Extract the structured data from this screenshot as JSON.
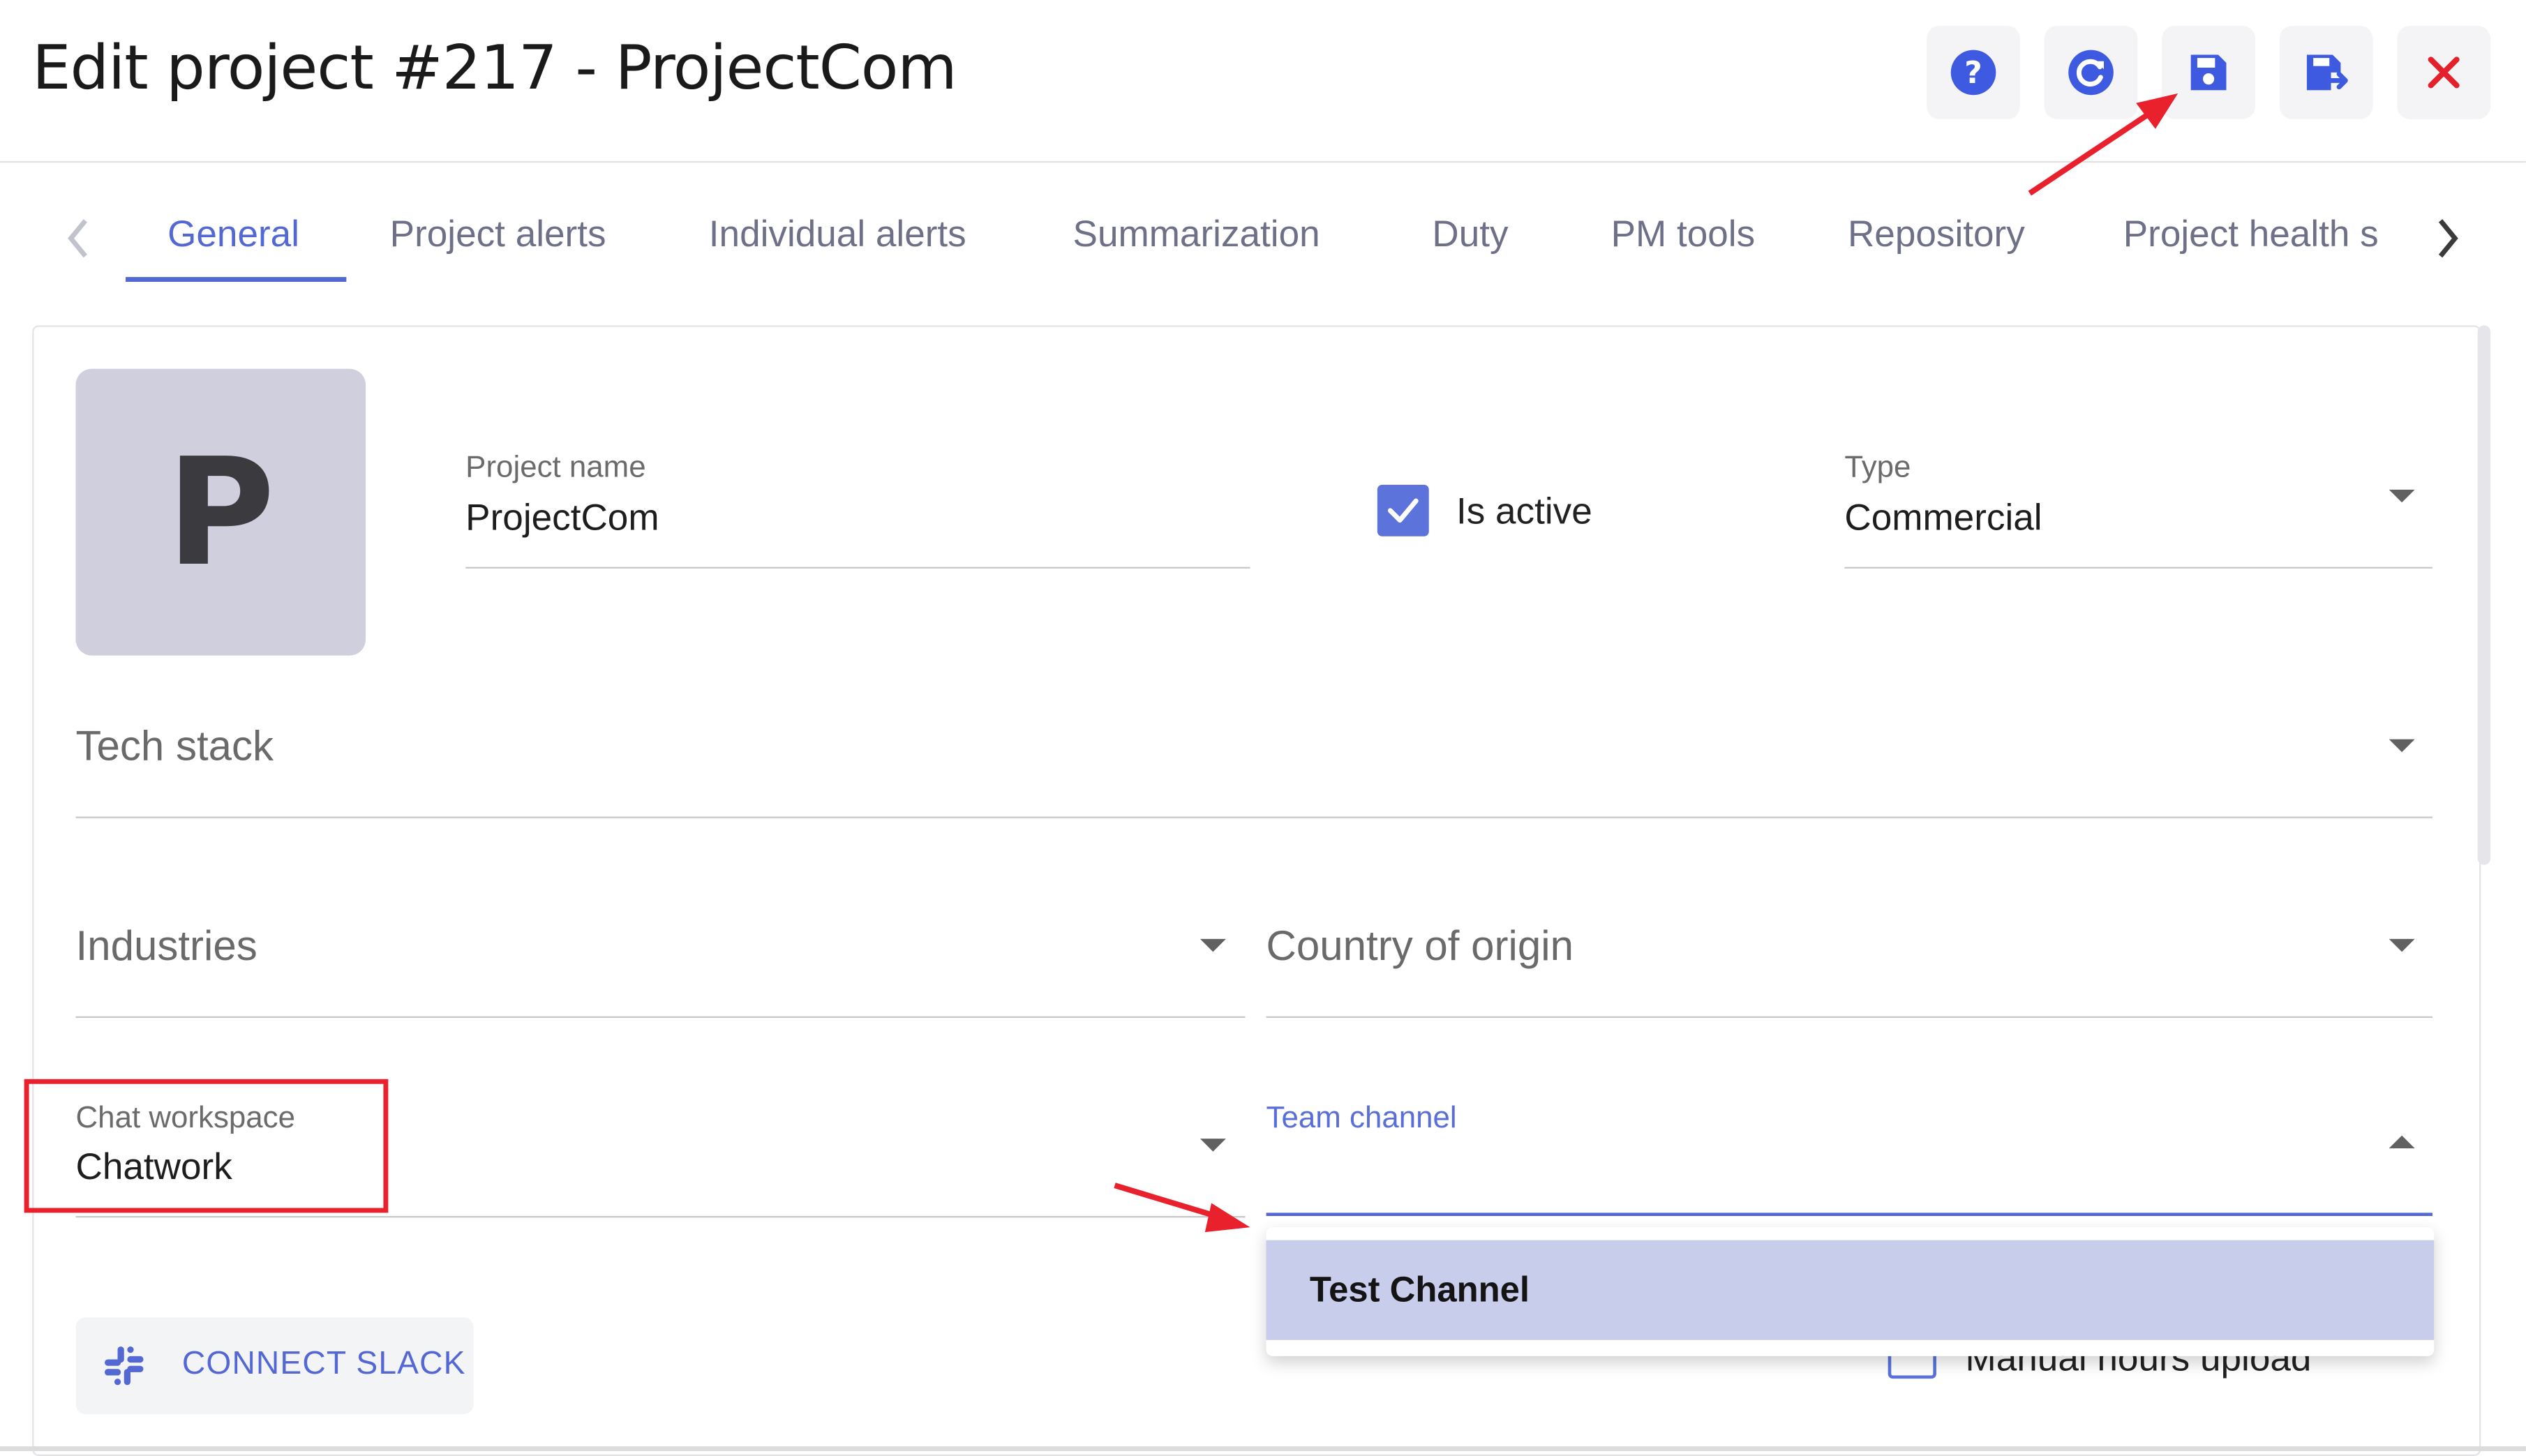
{
  "header": {
    "title": "Edit project #217 - ProjectCom",
    "buttons": [
      {
        "icon": "help-icon",
        "color": "#3d5ae0"
      },
      {
        "icon": "reset-icon",
        "color": "#3d5ae0"
      },
      {
        "icon": "save-icon",
        "color": "#3d5ae0"
      },
      {
        "icon": "save-and-close-icon",
        "color": "#3d5ae0"
      },
      {
        "icon": "close-icon",
        "color": "#e2212c"
      }
    ]
  },
  "tabs": {
    "items": [
      {
        "label": "General",
        "active": true
      },
      {
        "label": "Project alerts"
      },
      {
        "label": "Individual alerts"
      },
      {
        "label": "Summarization"
      },
      {
        "label": "Duty"
      },
      {
        "label": "PM tools"
      },
      {
        "label": "Repository"
      },
      {
        "label": "Project health s"
      }
    ]
  },
  "avatar": {
    "letter": "P"
  },
  "form": {
    "project_name": {
      "label": "Project name",
      "value": "ProjectCom"
    },
    "is_active": {
      "label": "Is active",
      "checked": true
    },
    "type": {
      "label": "Type",
      "value": "Commercial"
    },
    "tech_stack": {
      "placeholder": "Tech stack"
    },
    "industries": {
      "placeholder": "Industries"
    },
    "country_of_origin": {
      "placeholder": "Country of origin"
    },
    "chat_workspace": {
      "label": "Chat workspace",
      "value": "Chatwork"
    },
    "team_channel": {
      "label": "Team channel",
      "value": "",
      "open": true
    },
    "connect_slack": {
      "label": "CONNECT SLACK"
    },
    "manual_hours_upload": {
      "label": "Manual hours upload",
      "checked": false
    }
  },
  "dropdown": {
    "options": [
      "Test Channel"
    ]
  },
  "colors": {
    "accent": "#5468d4",
    "annotation_red": "#e8212c",
    "dropdown_highlight": "#c9cdec"
  }
}
